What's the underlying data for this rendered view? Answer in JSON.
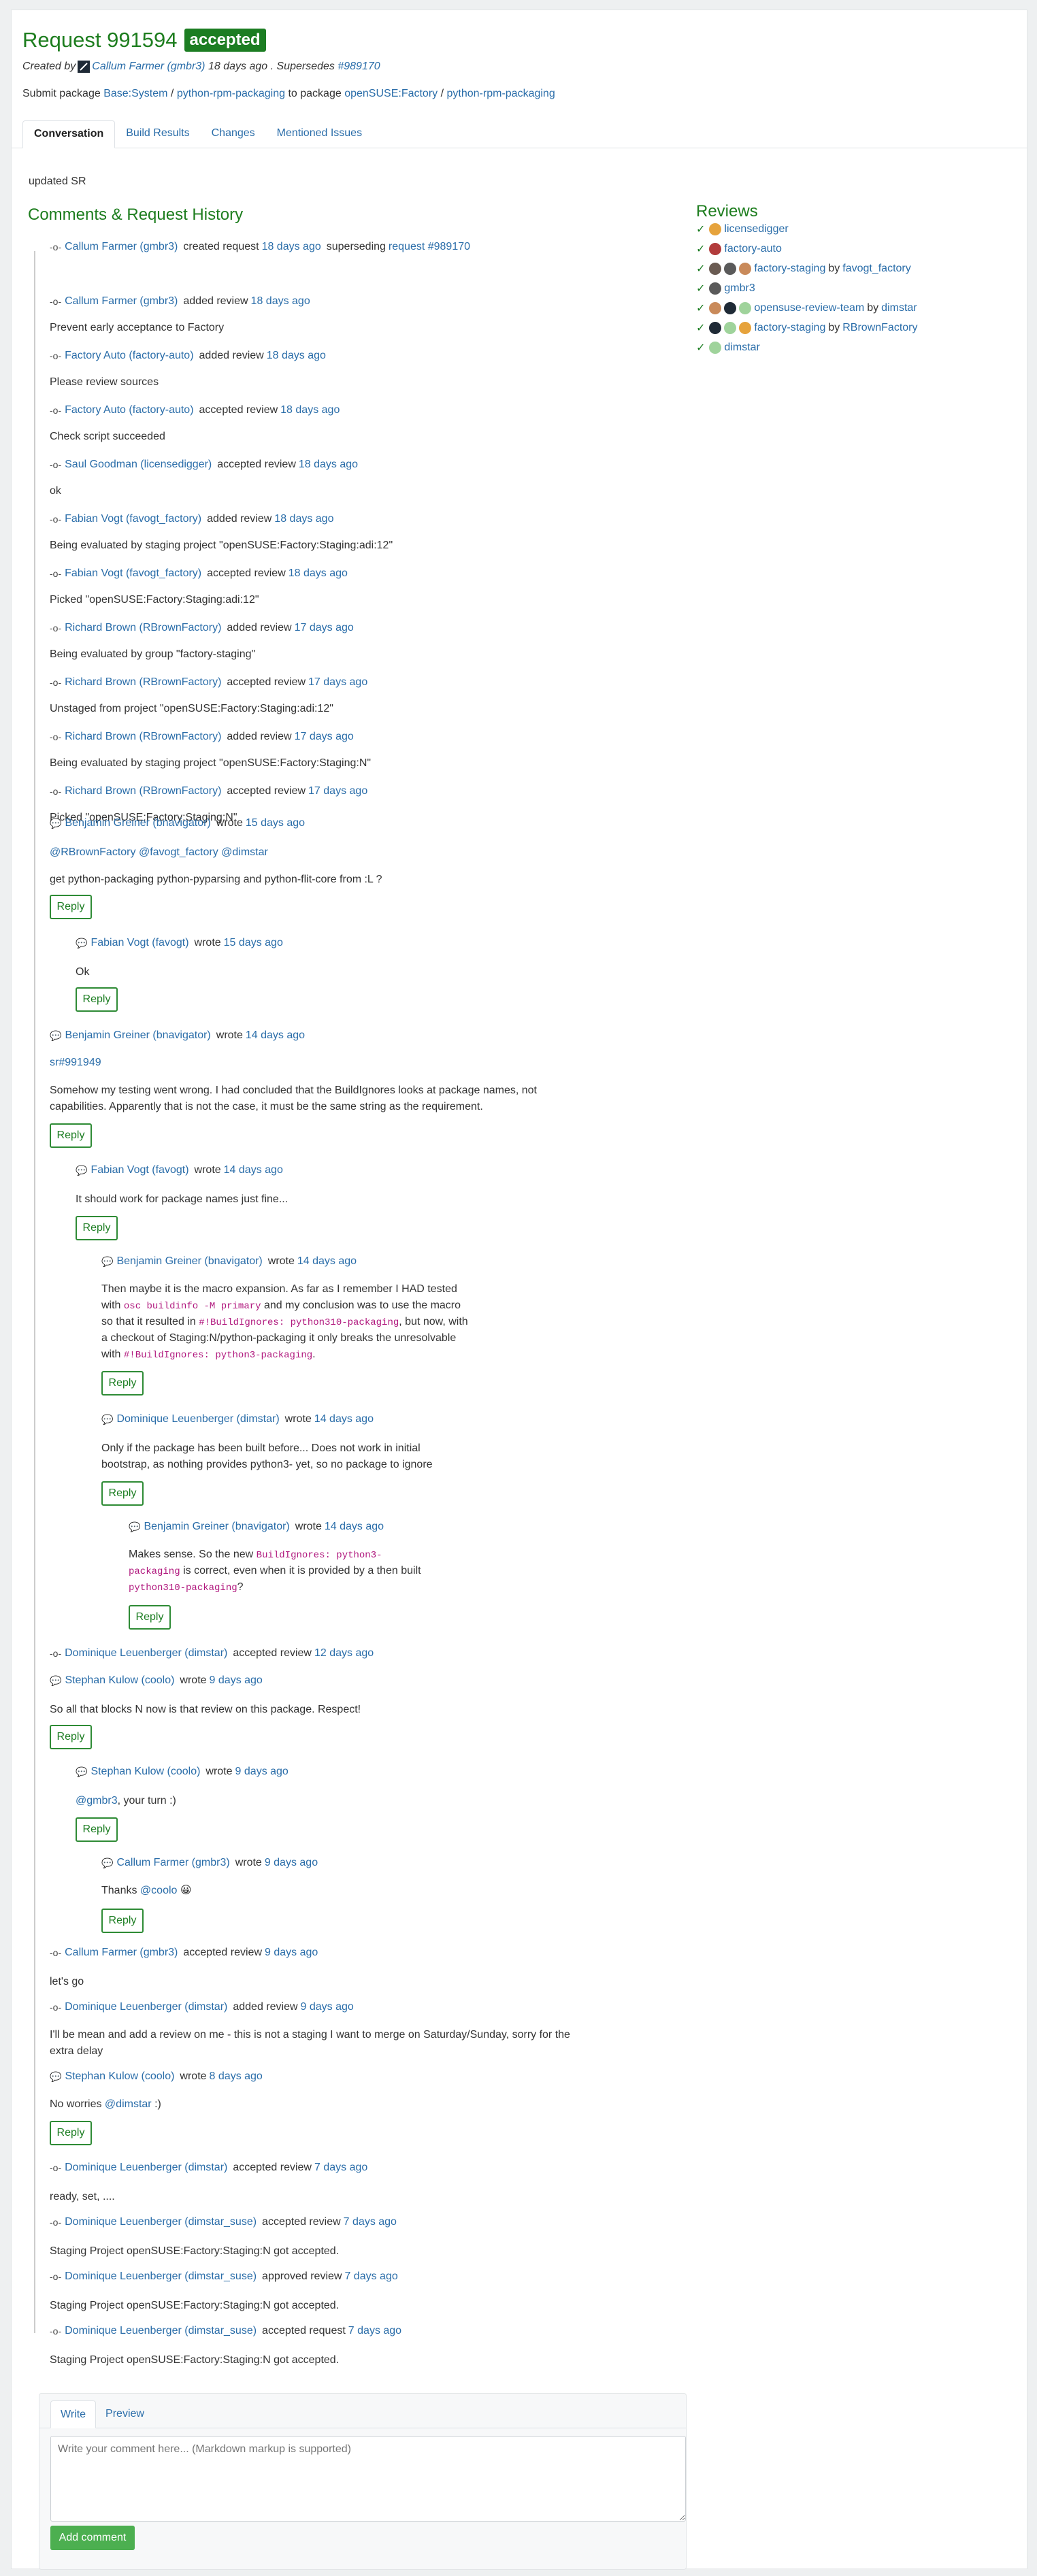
{
  "request": {
    "title": "Request 991594",
    "state": "accepted",
    "created_by_label": "Created by",
    "creator": "Callum Farmer (gmbr3)",
    "created_when": "18 days ago",
    "supersedes_label": ". Supersedes",
    "supersedes": "#989170",
    "submit_prefix": "Submit package",
    "src_project": "Base:System",
    "src_package": "python-rpm-packaging",
    "to_package_label": "to package",
    "tgt_project": "openSUSE:Factory",
    "tgt_package": "python-rpm-packaging",
    "slash": "/",
    "description": "updated SR"
  },
  "tabs": [
    "Conversation",
    "Build Results",
    "Changes",
    "Mentioned Issues"
  ],
  "headings": {
    "history": "Comments & Request History",
    "reviews": "Reviews"
  },
  "history": [
    {
      "who": "Callum Farmer (gmbr3)",
      "action": "created request",
      "when": "18 days ago",
      "extra": "superseding",
      "extra_link": "request #989170"
    },
    {
      "who": "Callum Farmer (gmbr3)",
      "action": "added review",
      "when": "18 days ago",
      "text": "Prevent early acceptance to Factory"
    },
    {
      "who": "Factory Auto (factory-auto)",
      "action": "added review",
      "when": "18 days ago",
      "text": "Please review sources"
    },
    {
      "who": "Factory Auto (factory-auto)",
      "action": "accepted review",
      "when": "18 days ago",
      "text": "Check script succeeded"
    },
    {
      "who": "Saul Goodman (licensedigger)",
      "action": "accepted review",
      "when": "18 days ago",
      "text": "ok"
    },
    {
      "who": "Fabian Vogt (favogt_factory)",
      "action": "added review",
      "when": "18 days ago",
      "text": "Being evaluated by staging project \"openSUSE:Factory:Staging:adi:12\""
    },
    {
      "who": "Fabian Vogt (favogt_factory)",
      "action": "accepted review",
      "when": "18 days ago",
      "text": "Picked \"openSUSE:Factory:Staging:adi:12\""
    },
    {
      "who": "Richard Brown (RBrownFactory)",
      "action": "added review",
      "when": "17 days ago",
      "text": "Being evaluated by group \"factory-staging\""
    },
    {
      "who": "Richard Brown (RBrownFactory)",
      "action": "accepted review",
      "when": "17 days ago",
      "text": "Unstaged from project \"openSUSE:Factory:Staging:adi:12\""
    },
    {
      "who": "Richard Brown (RBrownFactory)",
      "action": "added review",
      "when": "17 days ago",
      "text": "Being evaluated by staging project \"openSUSE:Factory:Staging:N\""
    },
    {
      "who": "Richard Brown (RBrownFactory)",
      "action": "accepted review",
      "when": "17 days ago",
      "text": "Picked \"openSUSE:Factory:Staging:N\""
    }
  ],
  "comments": {
    "c1": {
      "who": "Benjamin Greiner (bnavigator)",
      "action": "wrote",
      "when": "15 days ago",
      "mentions": [
        "@RBrownFactory",
        "@favogt_factory",
        "@dimstar"
      ],
      "text": "get python-packaging python-pyparsing and python-flit-core from :L ?"
    },
    "c1r": {
      "who": "Fabian Vogt (favogt)",
      "action": "wrote",
      "when": "15 days ago",
      "text": "Ok"
    },
    "c2": {
      "who": "Benjamin Greiner (bnavigator)",
      "action": "wrote",
      "when": "14 days ago",
      "link": "sr#991949",
      "text1": "Somehow my testing went wrong. I had concluded that the BuildIgnores looks at package names, not",
      "text2": "capabilities. Apparently that is not the case, it must be the same string as the requirement."
    },
    "c2r": {
      "who": "Fabian Vogt (favogt)",
      "action": "wrote",
      "when": "14 days ago",
      "text": "It should work for package names just fine..."
    },
    "c2rr": {
      "who": "Benjamin Greiner (bnavigator)",
      "action": "wrote",
      "when": "14 days ago",
      "l1": "Then maybe it is the macro expansion. As far as I remember I HAD tested",
      "l2a": "with",
      "l2code": "osc buildinfo -M primary",
      "l2b": "and my conclusion was to use the macro",
      "l3a": "so that it resulted in",
      "l3code": "#!BuildIgnores: python310-packaging",
      "l3b": ", but now, with",
      "l4": "a checkout of Staging:N/python-packaging it only breaks the unresolvable",
      "l5a": "with",
      "l5code": "#!BuildIgnores: python3-packaging",
      "l5b": "."
    },
    "c2rrr": {
      "who": "Dominique Leuenberger (dimstar)",
      "action": "wrote",
      "when": "14 days ago",
      "l1": "Only if the package has been built before... Does not work in initial",
      "l2": "bootstrap, as nothing provides python3- yet, so no package to ignore"
    },
    "c2rrrr": {
      "who": "Benjamin Greiner (bnavigator)",
      "action": "wrote",
      "when": "14 days ago",
      "l1a": "Makes sense. So the new",
      "l1code": "BuildIgnores: python3-",
      "l2code": "packaging",
      "l2b": "is correct, even when it is provided by a then built",
      "l3code": "python310-packaging",
      "l3b": "?"
    },
    "e1": {
      "who": "Dominique Leuenberger (dimstar)",
      "action": "accepted review",
      "when": "12 days ago"
    },
    "c3": {
      "who": "Stephan Kulow (coolo)",
      "action": "wrote",
      "when": "9 days ago",
      "text": "So all that blocks N now is that review on this package. Respect!"
    },
    "c3r": {
      "who": "Stephan Kulow (coolo)",
      "action": "wrote",
      "when": "9 days ago",
      "mention": "@gmbr3",
      "text": ", your turn :)"
    },
    "c3rr": {
      "who": "Callum Farmer (gmbr3)",
      "action": "wrote",
      "when": "9 days ago",
      "text_a": "Thanks",
      "mention": "@coolo",
      "emoji": "😀"
    },
    "e2": {
      "who": "Callum Farmer (gmbr3)",
      "action": "accepted review",
      "when": "9 days ago",
      "text": "let's go"
    },
    "e3": {
      "who": "Dominique Leuenberger (dimstar)",
      "action": "added review",
      "when": "9 days ago",
      "l1": "I'll be mean and add a review on me - this is not a staging I want to merge on Saturday/Sunday, sorry for the",
      "l2": "extra delay"
    },
    "c4": {
      "who": "Stephan Kulow (coolo)",
      "action": "wrote",
      "when": "8 days ago",
      "text_a": "No worries",
      "mention": "@dimstar",
      "text_b": ":)"
    },
    "e4": {
      "who": "Dominique Leuenberger (dimstar)",
      "action": "accepted review",
      "when": "7 days ago",
      "text": "ready, set, ...."
    },
    "e5": {
      "who": "Dominique Leuenberger (dimstar_suse)",
      "action": "accepted review",
      "when": "7 days ago",
      "text": "Staging Project openSUSE:Factory:Staging:N got accepted."
    },
    "e6": {
      "who": "Dominique Leuenberger (dimstar_suse)",
      "action": "approved review",
      "when": "7 days ago",
      "text": "Staging Project openSUSE:Factory:Staging:N got accepted."
    },
    "e7": {
      "who": "Dominique Leuenberger (dimstar_suse)",
      "action": "accepted request",
      "when": "7 days ago",
      "text": "Staging Project openSUSE:Factory:Staging:N got accepted."
    }
  },
  "reply_label": "Reply",
  "reviews": [
    {
      "who": "licensedigger"
    },
    {
      "who": "factory-auto"
    },
    {
      "who": "factory-staging",
      "by": "by",
      "by_who": "favogt_factory"
    },
    {
      "who": "gmbr3"
    },
    {
      "who": "opensuse-review-team",
      "by": "by",
      "by_who": "dimstar"
    },
    {
      "who": "factory-staging",
      "by": "by",
      "by_who": "RBrownFactory"
    },
    {
      "who": "dimstar"
    }
  ],
  "composer": {
    "tab_write": "Write",
    "tab_preview": "Preview",
    "placeholder": "Write your comment here... (Markdown markup is supported)",
    "submit": "Add comment"
  },
  "colors": {
    "accent": "#1d7d1e",
    "link": "#2a6da9",
    "button": "#4caf50"
  }
}
